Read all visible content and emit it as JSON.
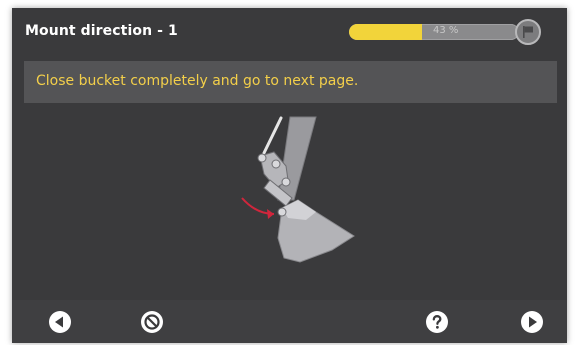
{
  "header": {
    "title": "Mount direction - 1",
    "progress_label": "43 %",
    "progress_fraction": 0.43,
    "flag_icon": "flag-icon"
  },
  "message": {
    "text": "Close bucket completely and go to next page."
  },
  "illustration": {
    "name": "excavator-bucket-close-illustration",
    "arrow_color": "#d0263c"
  },
  "footer": {
    "buttons": [
      {
        "name": "back-button",
        "icon": "arrow-left-icon"
      },
      {
        "name": "cancel-button",
        "icon": "cancel-icon"
      },
      {
        "name": "help-button",
        "icon": "question-icon"
      },
      {
        "name": "next-button",
        "icon": "arrow-right-icon"
      }
    ]
  },
  "colors": {
    "background": "#3a3a3c",
    "message_bar": "#545456",
    "accent_text": "#f3cf4a",
    "progress_fill": "#f2d43a"
  }
}
